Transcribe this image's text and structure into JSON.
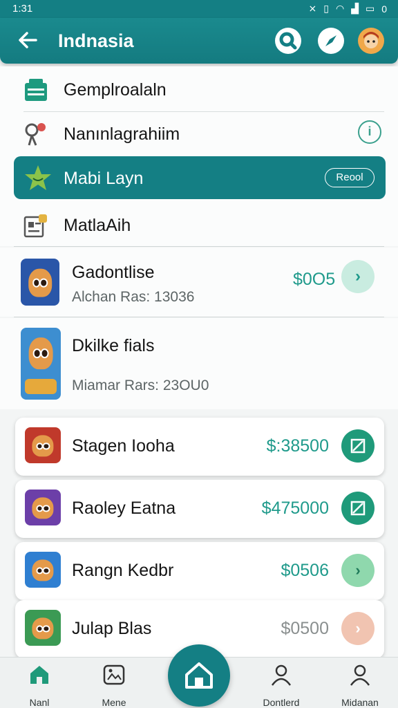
{
  "status_bar": {
    "time": "1:31",
    "battery": "0"
  },
  "app_bar": {
    "title": "Indnasia"
  },
  "menu": {
    "items": [
      {
        "label": "Gemplroalaln",
        "icon": "briefcase-icon"
      },
      {
        "label": "Nanınlagrahiim",
        "icon": "key-icon"
      },
      {
        "label": "Mabi Layn",
        "icon": "star-icon",
        "badge": "Reool"
      },
      {
        "label": "MatlaAih",
        "icon": "document-icon"
      }
    ]
  },
  "games": [
    {
      "name": "Gadontlise",
      "subtitle": "Alchan Ras: 13036",
      "price": "$0O5",
      "thumb_color": "#2a56a8"
    },
    {
      "name": "Dkilke fials",
      "subtitle": "Miamar Rars: 23OU0",
      "price": "",
      "thumb_color": "#3d8ed0"
    }
  ],
  "cards": [
    {
      "name": "Stagen Iooha",
      "price": "$:38500",
      "action_color": "#1f9a7a",
      "action_icon": "external-link-icon"
    },
    {
      "name": "Raoley Eatna",
      "price": "$475000",
      "action_color": "#1f9a7a",
      "action_icon": "external-link-icon"
    },
    {
      "name": "Rangn Kedbr",
      "price": "$0506",
      "action_color": "#8fd8ad",
      "action_icon": "chevron-right-icon"
    },
    {
      "name": "Julap Blas",
      "price": "$0500",
      "action_color": "#f1c4b1",
      "action_icon": "skip-forward-icon"
    }
  ],
  "bottom_nav": {
    "items": [
      {
        "label": "Nanl"
      },
      {
        "label": "Mene"
      },
      {
        "label": "Dontlerd"
      },
      {
        "label": "Midanan"
      }
    ]
  },
  "colors": {
    "primary": "#147f84",
    "accent": "#1f9a8b",
    "highlight": "#f0a84a"
  }
}
